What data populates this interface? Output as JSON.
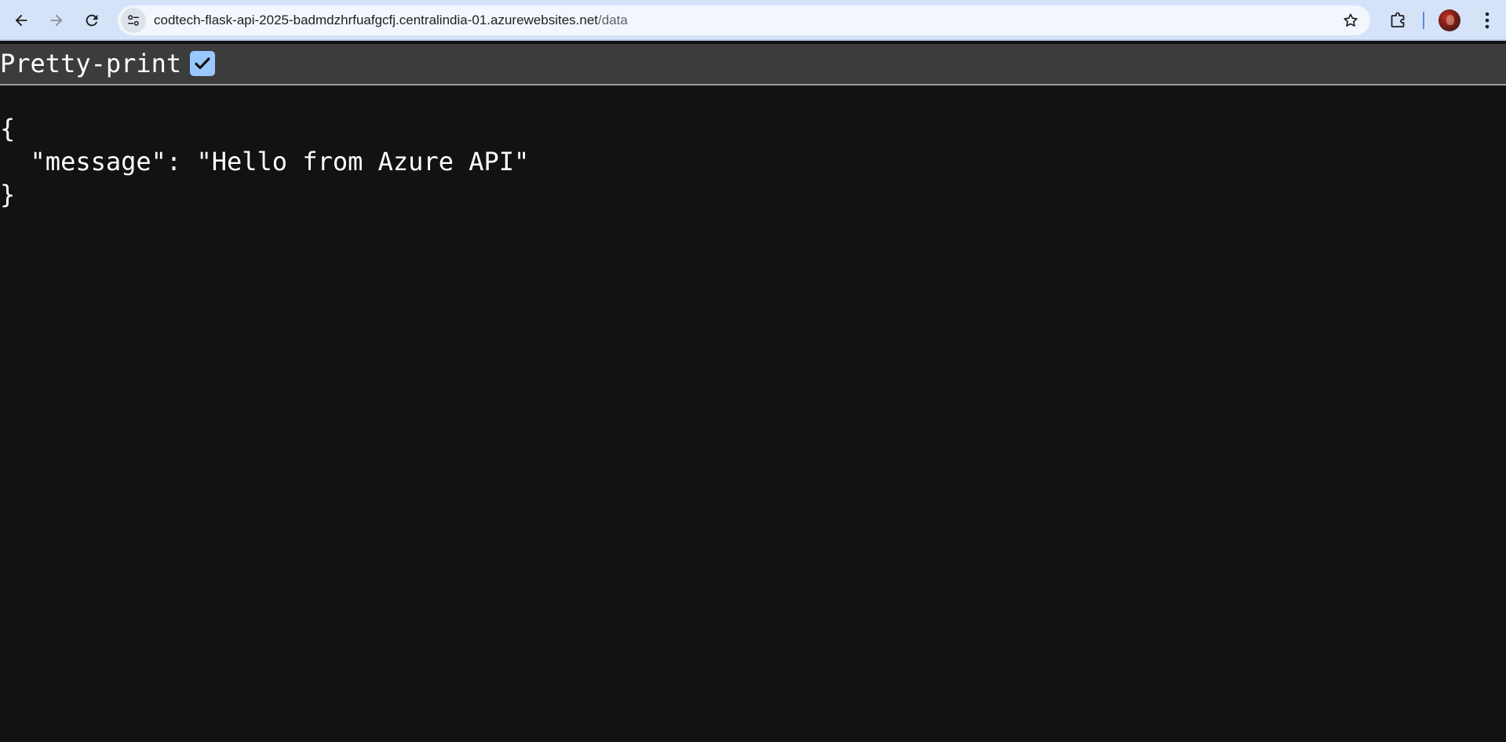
{
  "browser": {
    "url_host": "codtech-flask-api-2025-badmdzhrfuafgcfj.centralindia-01.azurewebsites.net",
    "url_path": "/data",
    "icons": {
      "back": "arrow-left-icon",
      "forward": "arrow-right-icon",
      "reload": "reload-icon",
      "site_info": "tune-icon",
      "bookmark": "star-icon",
      "extensions": "puzzle-icon",
      "menu": "kebab-menu-icon"
    }
  },
  "viewer": {
    "pretty_print_label": "Pretty-print",
    "pretty_print_checked": true,
    "json_lines": [
      "{",
      "  \"message\": \"Hello from Azure API\"",
      "}"
    ]
  },
  "colors": {
    "toolbar_bg": "#d5e3f9",
    "page_bg": "#121212",
    "pretty_print_bar_bg": "#3c3c3c",
    "checkbox_accent": "#99c8ff"
  }
}
